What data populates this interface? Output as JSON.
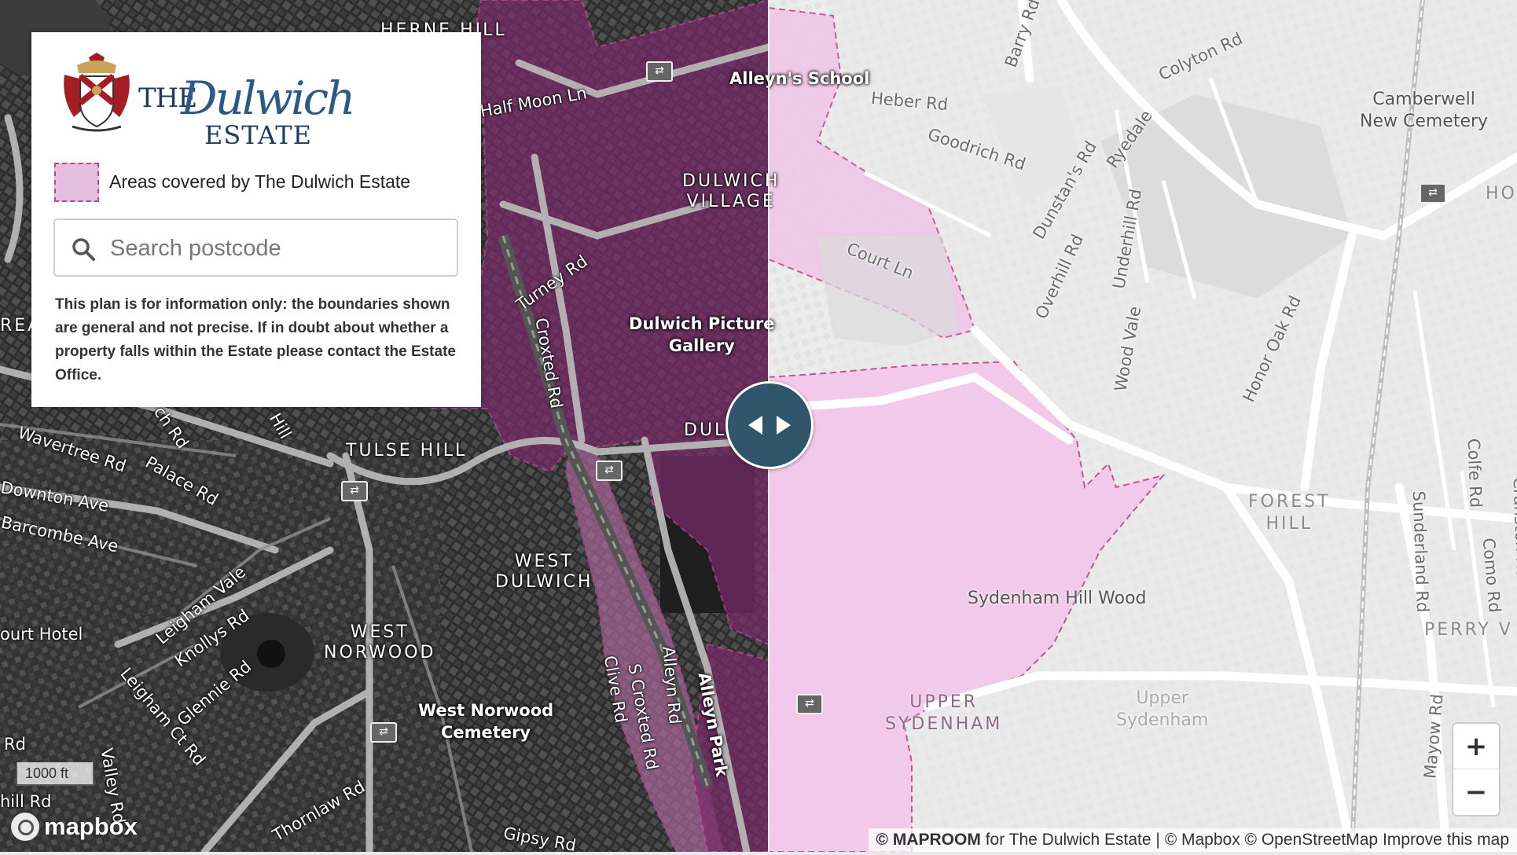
{
  "logo": {
    "the": "THE",
    "dulwich": "Dulwich",
    "estate": "ESTATE"
  },
  "legend": {
    "label": "Areas covered by The Dulwich Estate",
    "fill_color": "#e5bfe0",
    "border_color": "#c04490"
  },
  "search": {
    "placeholder": "Search postcode",
    "value": ""
  },
  "disclaimer": "This plan is for information only: the boundaries shown are general and not precise. If in doubt about whether a property falls within the Estate please contact the Estate Office.",
  "map_labels": {
    "herne_hill": "HERNE HILL",
    "half_moon_ln": "Half Moon Ln",
    "alleyns_school": "Alleyn's School",
    "dulwich_village": "DULWICH\nVILLAGE",
    "turney_rd": "Turney Rd",
    "croxted_rd": "Croxted Rd",
    "dulwich_picture_gallery": "Dulwich Picture\nGallery",
    "dul": "DUL",
    "tulse_hill": "TULSE HILL",
    "wavertree_rd": "Wavertree Rd",
    "palace_rd": "Palace Rd",
    "downton_ave": "Downton Ave",
    "barcombe_ave": "Barcombe Ave",
    "west_dulwich": "WEST\nDULWICH",
    "leigham_vale": "Leigham Vale",
    "knollys_rd": "Knollys Rd",
    "court_hotel": "ourt Hotel",
    "west_norwood": "WEST\nNORWOOD",
    "glennie_rd": "Glennie Rd",
    "leigham_ct_rd": "Leigham Ct Rd",
    "west_norwood_cemetery": "West Norwood\nCemetery",
    "clive_rd": "Clive Rd",
    "s_croxted_rd": "S Croxted Rd",
    "alleyn_rd": "Alleyn Rd",
    "alleyn_park": "Alleyn Park",
    "thornlaw_rd": "Thornlaw Rd",
    "gipsy_rd": "Gipsy Rd",
    "rea": "REA",
    "ch_rd": "ch Rd",
    "hill": "Hill",
    "rd_left": "Rd",
    "hill_rd": "hill Rd",
    "valley_rd": "Valley Rd",
    "barry_rd": "Barry Rd",
    "colyton_rd": "Colyton Rd",
    "heber_rd": "Heber Rd",
    "goodrich_rd": "Goodrich Rd",
    "camberwell_new_cemetery": "Camberwell\nNew Cemetery",
    "dunstans_rd": "Dunstan's Rd",
    "ryedale": "Ryedale",
    "underhill_rd": "Underhill Rd",
    "overhill_rd": "Overhill Rd",
    "court_ln": "Court Ln",
    "wood_vale": "Wood Vale",
    "honor_oak_rd": "Honor Oak Rd",
    "ho": "HO",
    "forest_hill": "FOREST\nHILL",
    "sunderland_rd": "Sunderland Rd",
    "colfe_rd": "Colfe Rd",
    "como_rd": "Como Rd",
    "cranston_rd": "Cranston Rd",
    "sydenham_hill_wood": "Sydenham Hill Wood",
    "perry_v": "PERRY V",
    "upper_sydenham_area": "UPPER\nSYDENHAM",
    "upper_sydenham": "Upper\nSydenham",
    "mayow_rd": "Mayow Rd"
  },
  "scale": "1000 ft",
  "mapbox_logo": "mapbox",
  "zoom": {
    "in": "+",
    "out": "−"
  },
  "attribution": {
    "maproom": "© MAPROOM",
    "for": " for The Dulwich Estate | © Mapbox © OpenStreetMap ",
    "improve": "Improve this map"
  },
  "colors": {
    "estate_fill": "#e5bfe0",
    "estate_border": "#c04490",
    "handle": "#31566b"
  }
}
